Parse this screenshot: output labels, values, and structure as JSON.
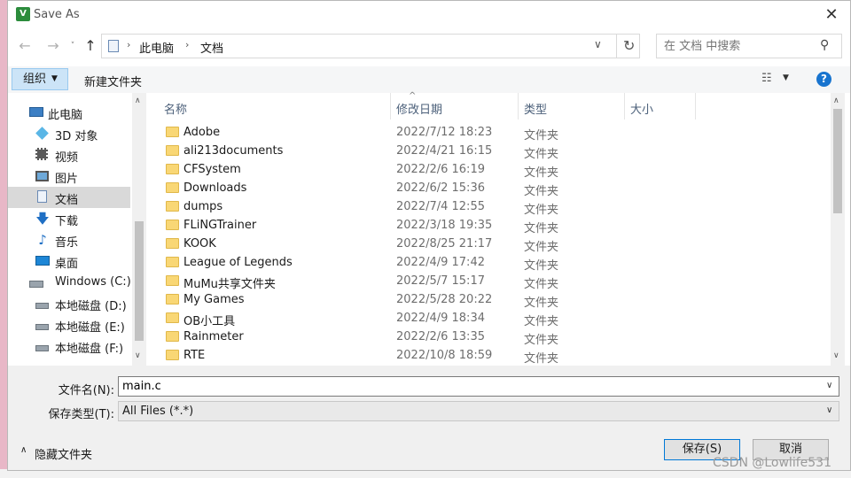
{
  "window": {
    "title": "Save As",
    "app_icon": "V"
  },
  "nav": {
    "back": "←",
    "forward": "→",
    "history": "˅",
    "up": "↑",
    "breadcrumbs": [
      "此电脑",
      "文档"
    ],
    "separator": "›",
    "dropdown": "∨",
    "refresh": "↻",
    "search_placeholder": "在 文档 中搜索",
    "search_icon": "⚲"
  },
  "toolbar": {
    "organize": "组织",
    "organize_arrow": "▼",
    "new_folder": "新建文件夹",
    "view_icon": "☷",
    "view_arrow": "▼",
    "help": "?"
  },
  "tree": {
    "items": [
      {
        "label": "此电脑",
        "icon": "computer-icon"
      },
      {
        "label": "3D 对象",
        "icon": "cube-icon"
      },
      {
        "label": "视频",
        "icon": "video-icon"
      },
      {
        "label": "图片",
        "icon": "picture-icon"
      },
      {
        "label": "文档",
        "icon": "document-icon",
        "selected": true
      },
      {
        "label": "下载",
        "icon": "download-icon"
      },
      {
        "label": "音乐",
        "icon": "music-icon"
      },
      {
        "label": "桌面",
        "icon": "desktop-icon"
      },
      {
        "label": "Windows (C:)",
        "icon": "windows-drive-icon"
      },
      {
        "label": "本地磁盘 (D:)",
        "icon": "drive-icon"
      },
      {
        "label": "本地磁盘 (E:)",
        "icon": "drive-icon"
      },
      {
        "label": "本地磁盘 (F:)",
        "icon": "drive-icon"
      }
    ],
    "scroll_up": "∧",
    "scroll_down": "∨"
  },
  "columns": {
    "name": "名称",
    "date": "修改日期",
    "type": "类型",
    "size": "大小",
    "sort_arrow": "^"
  },
  "files": [
    {
      "name": "Adobe",
      "date": "2022/7/12 18:23",
      "type": "文件夹"
    },
    {
      "name": "ali213documents",
      "date": "2022/4/21 16:15",
      "type": "文件夹"
    },
    {
      "name": "CFSystem",
      "date": "2022/2/6 16:19",
      "type": "文件夹"
    },
    {
      "name": "Downloads",
      "date": "2022/6/2 15:36",
      "type": "文件夹"
    },
    {
      "name": "dumps",
      "date": "2022/7/4 12:55",
      "type": "文件夹"
    },
    {
      "name": "FLiNGTrainer",
      "date": "2022/3/18 19:35",
      "type": "文件夹"
    },
    {
      "name": "KOOK",
      "date": "2022/8/25 21:17",
      "type": "文件夹"
    },
    {
      "name": "League of Legends",
      "date": "2022/4/9 17:42",
      "type": "文件夹"
    },
    {
      "name": "MuMu共享文件夹",
      "date": "2022/5/7 15:17",
      "type": "文件夹"
    },
    {
      "name": "My Games",
      "date": "2022/5/28 20:22",
      "type": "文件夹"
    },
    {
      "name": "OB小工具",
      "date": "2022/4/9 18:34",
      "type": "文件夹"
    },
    {
      "name": "Rainmeter",
      "date": "2022/2/6 13:35",
      "type": "文件夹"
    },
    {
      "name": "RTE",
      "date": "2022/10/8 18:59",
      "type": "文件夹"
    }
  ],
  "form": {
    "filename_label": "文件名(N):",
    "filename_value": "main.c",
    "filetype_label": "保存类型(T):",
    "filetype_value": "All Files (*.*)",
    "combo_arrow": "∨",
    "hide_folders_arrow": "∧",
    "hide_folders": "隐藏文件夹",
    "save": "保存(S)",
    "cancel": "取消"
  },
  "watermark": "CSDN @Lowlife531"
}
